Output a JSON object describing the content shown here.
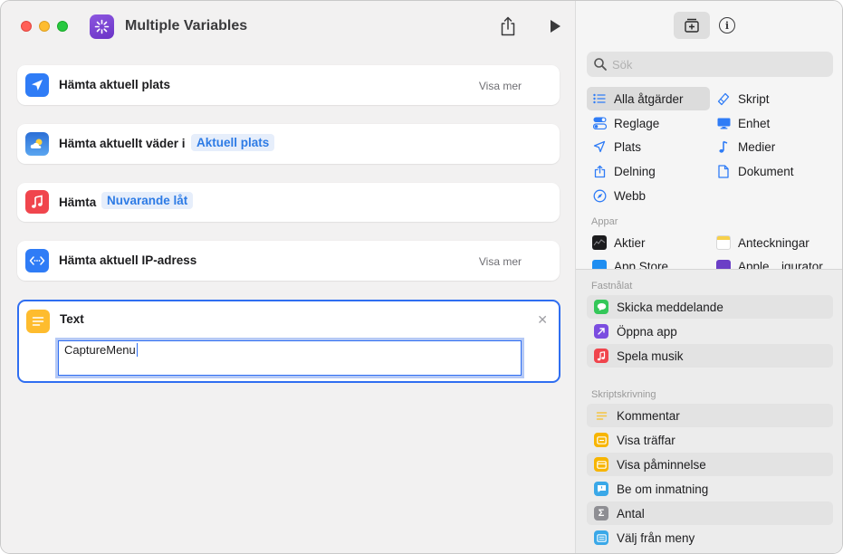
{
  "window": {
    "title": "Multiple Variables"
  },
  "editor": {
    "actions": [
      {
        "label": "Hämta aktuell plats",
        "more": "Visa mer",
        "icon": "location-arrow-icon",
        "color": "#2f7cf6"
      },
      {
        "label": "Hämta aktuellt väder i",
        "token": "Aktuell plats",
        "icon": "weather-icon",
        "color": "#3b8ee6"
      },
      {
        "label": "Hämta",
        "token": "Nuvarande låt",
        "icon": "music-note-icon",
        "color": "#f0454d"
      },
      {
        "label": "Hämta aktuell IP-adress",
        "more": "Visa mer",
        "icon": "network-icon",
        "color": "#2f7cf6"
      }
    ],
    "text_action": {
      "label": "Text",
      "value": "CaptureMenu",
      "icon": "text-lines-icon",
      "color": "#febc2e"
    }
  },
  "library": {
    "search": {
      "placeholder": "Sök"
    },
    "categories": [
      {
        "label": "Alla åtgärder",
        "icon": "list-icon",
        "selected": true
      },
      {
        "label": "Skript",
        "icon": "script-icon"
      },
      {
        "label": "Reglage",
        "icon": "toggle-icon"
      },
      {
        "label": "Enhet",
        "icon": "display-icon"
      },
      {
        "label": "Plats",
        "icon": "location-icon"
      },
      {
        "label": "Medier",
        "icon": "music-note-icon"
      },
      {
        "label": "Delning",
        "icon": "share-icon"
      },
      {
        "label": "Dokument",
        "icon": "document-icon"
      },
      {
        "label": "Webb",
        "icon": "compass-icon"
      }
    ],
    "apps_heading": "Appar",
    "apps": [
      {
        "label": "Aktier",
        "icon": "stocks-icon"
      },
      {
        "label": "Anteckningar",
        "icon": "notes-icon"
      },
      {
        "label": "App Store",
        "icon": "app-store-icon"
      },
      {
        "label": "Apple…igurator",
        "icon": "configurator-icon"
      }
    ],
    "pinned_heading": "Fastnålat",
    "pinned": [
      {
        "label": "Skicka meddelande",
        "icon": "message-icon",
        "color": "#34c759"
      },
      {
        "label": "Öppna app",
        "icon": "open-app-icon",
        "color": "#7b4de0"
      },
      {
        "label": "Spela musik",
        "icon": "music-icon",
        "color": "#f0454d"
      }
    ],
    "scripting_heading": "Skriptskrivning",
    "scripting": [
      {
        "label": "Kommentar",
        "icon": "comment-icon",
        "color": "#f5c542"
      },
      {
        "label": "Visa träffar",
        "icon": "show-result-icon",
        "color": "#f7b500"
      },
      {
        "label": "Visa påminnelse",
        "icon": "alert-icon",
        "color": "#f7b500"
      },
      {
        "label": "Be om inmatning",
        "icon": "ask-input-icon",
        "color": "#3aa8e8"
      },
      {
        "label": "Antal",
        "icon": "sigma-icon",
        "color": "#8e8e93"
      },
      {
        "label": "Välj från meny",
        "icon": "menu-icon",
        "color": "#3aa8e8"
      }
    ]
  }
}
